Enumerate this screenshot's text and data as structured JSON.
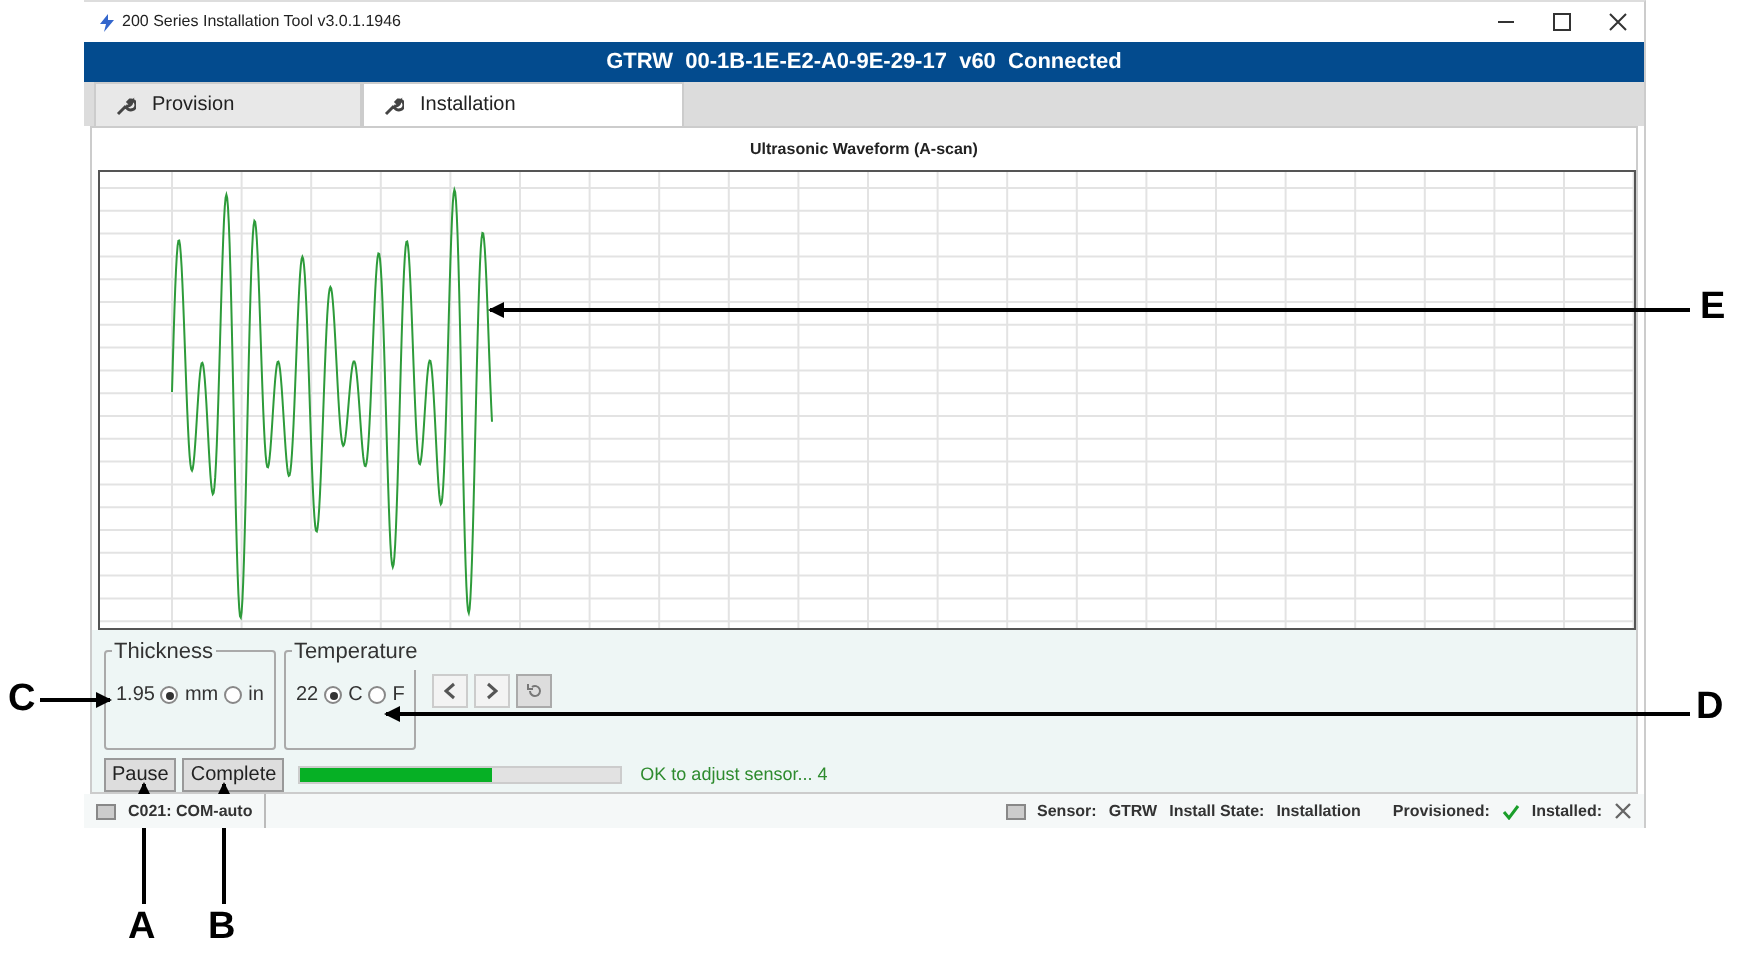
{
  "window": {
    "title": "200 Series Installation Tool v3.0.1.1946"
  },
  "header": {
    "text": "GTRW  00-1B-1E-E2-A0-9E-29-17  v60  Connected"
  },
  "tabs": [
    {
      "label": "Provision",
      "selected": false
    },
    {
      "label": "Installation",
      "selected": true
    }
  ],
  "chart_title": "Ultrasonic Waveform (A-scan)",
  "thickness": {
    "title": "Thickness",
    "value": "1.95",
    "units": [
      {
        "label": "mm",
        "selected": true
      },
      {
        "label": "in",
        "selected": false
      }
    ]
  },
  "temperature": {
    "title": "Temperature",
    "value": "22",
    "units": [
      {
        "label": "C",
        "selected": true
      },
      {
        "label": "F",
        "selected": false
      }
    ]
  },
  "buttons": [
    "Pause",
    "Complete"
  ],
  "progress": {
    "level": 0.6,
    "message": "OK to adjust sensor... 4"
  },
  "status_bar": {
    "port": "C021: COM-auto",
    "sensor_label": "Sensor:",
    "sensor": "GTRW",
    "install_state_label": "Install State:",
    "install_state": "Installation",
    "provisioned_label": "Provisioned:",
    "provisioned": true,
    "installed_label": "Installed:",
    "installed": false
  },
  "annotations": [
    "A",
    "B",
    "C",
    "D",
    "E"
  ]
}
